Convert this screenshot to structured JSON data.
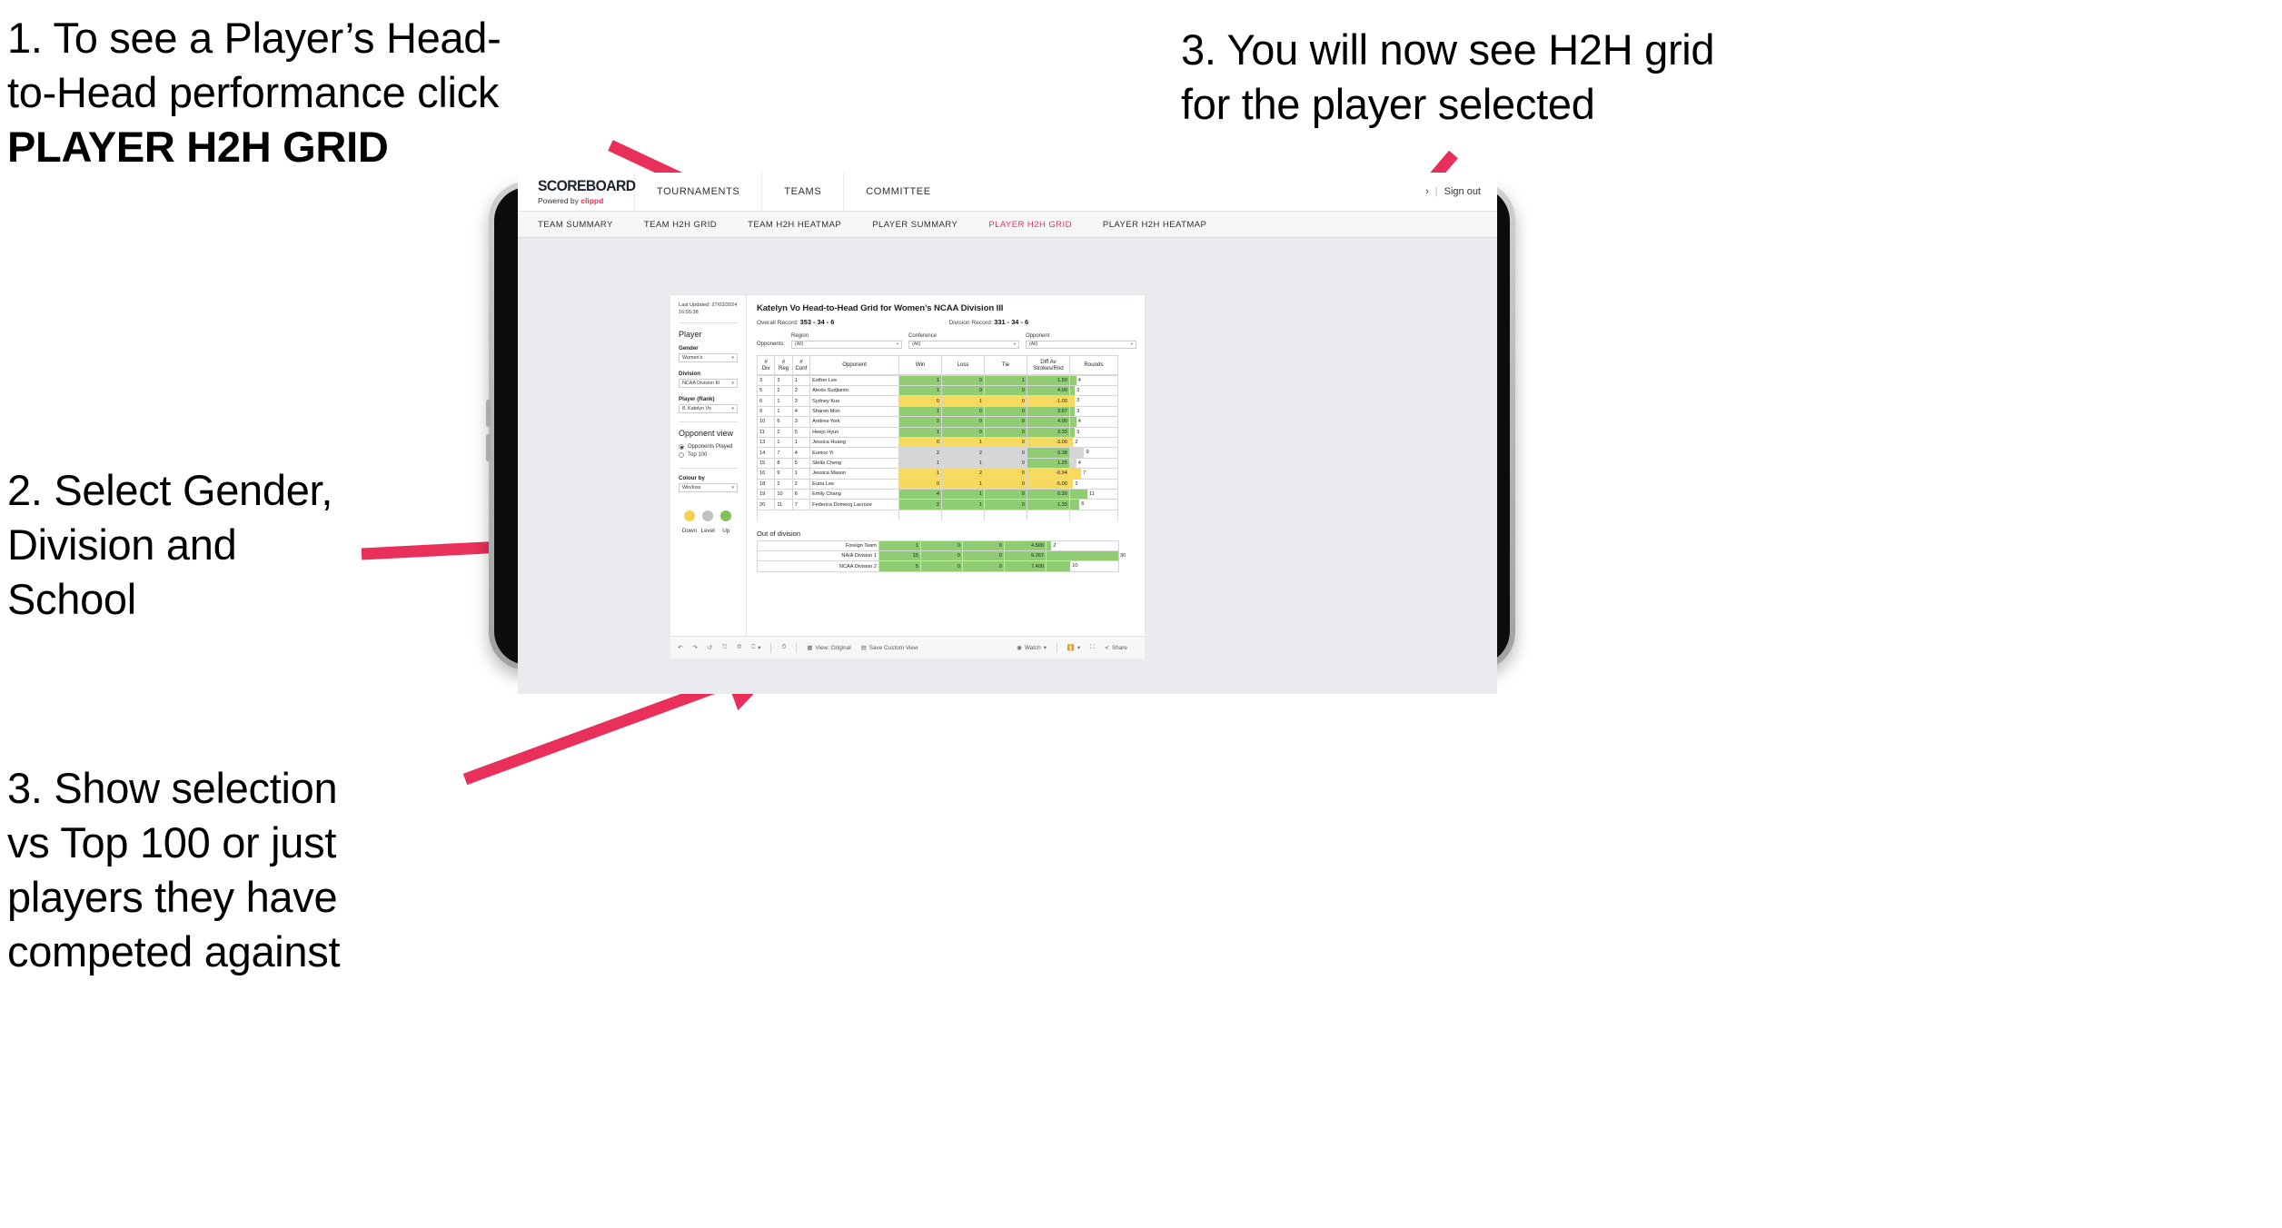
{
  "annotations": [
    {
      "id": "step1",
      "lines": [
        "1. To see a Player’s Head-",
        "to-Head performance click"
      ],
      "bold_line": "PLAYER H2H GRID"
    },
    {
      "id": "step2",
      "lines": [
        "2. Select Gender,",
        "Division and",
        "School"
      ]
    },
    {
      "id": "step3",
      "lines": [
        "3. Show selection",
        "vs Top 100 or just",
        "players they have",
        "competed against"
      ]
    },
    {
      "id": "step4",
      "lines": [
        "3. You will now see H2H grid",
        "for the player selected"
      ]
    }
  ],
  "accent_color": "#e8305a",
  "app": {
    "brand": {
      "name": "SCOREBOARD",
      "tagline_prefix": "Powered by ",
      "tagline_brand": "clippd"
    },
    "topnav": [
      "TOURNAMENTS",
      "TEAMS",
      "COMMITTEE"
    ],
    "account": {
      "chevron": "›",
      "separator": "|",
      "signout": "Sign out"
    },
    "subnav": [
      {
        "label": "TEAM SUMMARY",
        "active": false
      },
      {
        "label": "TEAM H2H GRID",
        "active": false
      },
      {
        "label": "TEAM H2H HEATMAP",
        "active": false
      },
      {
        "label": "PLAYER SUMMARY",
        "active": false
      },
      {
        "label": "PLAYER H2H GRID",
        "active": true
      },
      {
        "label": "PLAYER H2H HEATMAP",
        "active": false
      }
    ]
  },
  "filters": {
    "last_updated_label": "Last Updated: 27/03/2024",
    "last_updated_time": "16:55:38",
    "player_section_title": "Player",
    "gender": {
      "label": "Gender",
      "value": "Women's"
    },
    "division": {
      "label": "Division",
      "value": "NCAA Division III"
    },
    "player_rank": {
      "label": "Player (Rank)",
      "value": "8. Katelyn Vo"
    },
    "opponent_view": {
      "title": "Opponent view",
      "options": [
        {
          "label": "Opponents Played",
          "selected": true
        },
        {
          "label": "Top 100",
          "selected": false
        }
      ]
    },
    "colour_by": {
      "label": "Colour by",
      "value": "Win/loss"
    },
    "legend": [
      {
        "label": "Down",
        "color": "#f2d24b"
      },
      {
        "label": "Level",
        "color": "#bfc1c3"
      },
      {
        "label": "Up",
        "color": "#7ec35a"
      }
    ]
  },
  "viz": {
    "title": "Katelyn Vo Head-to-Head Grid for Women’s NCAA Division III",
    "overall_record_label": "Overall Record:",
    "overall_record_value": "353 -  34 - 6",
    "division_record_label": "Division Record:",
    "division_record_value": "331 -  34 - 6",
    "opponents_label": "Opponents:",
    "opponent_filters": [
      {
        "title": "Region",
        "value": "(All)"
      },
      {
        "title": "Conference",
        "value": "(All)"
      },
      {
        "title": "Opponent",
        "value": "(All)"
      }
    ],
    "columns": [
      "#\nDiv",
      "#\nReg",
      "#\nConf",
      "Opponent",
      "Win",
      "Loss",
      "Tie",
      "Diff Av\nStrokes/Rnd",
      "Rounds"
    ],
    "column_labels": {
      "div_1": "#",
      "div_2": "Div",
      "reg_1": "#",
      "reg_2": "Reg",
      "conf_1": "#",
      "conf_2": "Conf",
      "opponent": "Opponent",
      "win": "Win",
      "loss": "Loss",
      "tie": "Tie",
      "diff_1": "Diff Av",
      "diff_2": "Strokes/Rnd",
      "rounds": "Rounds"
    },
    "out_of_division_title": "Out of division"
  },
  "chart_data": {
    "type": "table",
    "title": "Katelyn Vo Head-to-Head Grid for Women’s NCAA Division III",
    "columns": [
      "# Div",
      "# Reg",
      "# Conf",
      "Opponent",
      "Win",
      "Loss",
      "Tie",
      "Diff Av Strokes/Rnd",
      "Rounds"
    ],
    "rows": [
      {
        "div": "3",
        "reg": "3",
        "conf": "1",
        "opponent": "Esther Lee",
        "win": "1",
        "loss": "0",
        "tie": "1",
        "diff": "1.50",
        "rounds": "4",
        "state": "up"
      },
      {
        "div": "5",
        "reg": "2",
        "conf": "2",
        "opponent": "Alexis Sudjianto",
        "win": "1",
        "loss": "0",
        "tie": "0",
        "diff": "4.00",
        "rounds": "3",
        "state": "up"
      },
      {
        "div": "6",
        "reg": "1",
        "conf": "3",
        "opponent": "Sydney Kuo",
        "win": "0",
        "loss": "1",
        "tie": "0",
        "diff": "-1.00",
        "rounds": "3",
        "state": "down"
      },
      {
        "div": "9",
        "reg": "1",
        "conf": "4",
        "opponent": "Sharon Mun",
        "win": "1",
        "loss": "0",
        "tie": "0",
        "diff": "3.67",
        "rounds": "3",
        "state": "up"
      },
      {
        "div": "10",
        "reg": "6",
        "conf": "3",
        "opponent": "Andrea York",
        "win": "2",
        "loss": "0",
        "tie": "0",
        "diff": "4.00",
        "rounds": "4",
        "state": "up"
      },
      {
        "div": "11",
        "reg": "2",
        "conf": "5",
        "opponent": "Heejo Hyun",
        "win": "1",
        "loss": "0",
        "tie": "0",
        "diff": "3.33",
        "rounds": "3",
        "state": "up"
      },
      {
        "div": "13",
        "reg": "1",
        "conf": "1",
        "opponent": "Jessica Huang",
        "win": "0",
        "loss": "1",
        "tie": "0",
        "diff": "-3.00",
        "rounds": "2",
        "state": "down"
      },
      {
        "div": "14",
        "reg": "7",
        "conf": "4",
        "opponent": "Eunice Yi",
        "win": "2",
        "loss": "2",
        "tie": "0",
        "diff": "0.38",
        "rounds": "9",
        "state": "level"
      },
      {
        "div": "15",
        "reg": "8",
        "conf": "5",
        "opponent": "Stella Cheng",
        "win": "1",
        "loss": "1",
        "tie": "0",
        "diff": "1.25",
        "rounds": "4",
        "state": "level"
      },
      {
        "div": "16",
        "reg": "9",
        "conf": "1",
        "opponent": "Jessica Mason",
        "win": "1",
        "loss": "2",
        "tie": "0",
        "diff": "-0.94",
        "rounds": "7",
        "state": "down"
      },
      {
        "div": "18",
        "reg": "2",
        "conf": "2",
        "opponent": "Euna Lee",
        "win": "0",
        "loss": "1",
        "tie": "0",
        "diff": "-5.00",
        "rounds": "2",
        "state": "down"
      },
      {
        "div": "19",
        "reg": "10",
        "conf": "6",
        "opponent": "Emily Chang",
        "win": "4",
        "loss": "1",
        "tie": "0",
        "diff": "0.30",
        "rounds": "11",
        "state": "up"
      },
      {
        "div": "20",
        "reg": "11",
        "conf": "7",
        "opponent": "Federica Domecq Lacroze",
        "win": "2",
        "loss": "1",
        "tie": "0",
        "diff": "1.33",
        "rounds": "6",
        "state": "up"
      }
    ],
    "out_of_division": [
      {
        "name": "Foreign Team",
        "win": "1",
        "loss": "0",
        "tie": "0",
        "diff": "4.500",
        "rounds": "2",
        "state": "up"
      },
      {
        "name": "NAIA Division 1",
        "win": "15",
        "loss": "0",
        "tie": "0",
        "diff": "9.267",
        "rounds": "30",
        "state": "up"
      },
      {
        "name": "NCAA Division 2",
        "win": "5",
        "loss": "0",
        "tie": "0",
        "diff": "7.400",
        "rounds": "10",
        "state": "up"
      }
    ],
    "colors": {
      "up": "#8fcc72",
      "down": "#f5da5f",
      "level": "#d4d6d7"
    },
    "max_rounds": 30
  },
  "toolbar": {
    "items": [
      {
        "icon": "undo-icon",
        "label": ""
      },
      {
        "icon": "redo-icon",
        "label": ""
      },
      {
        "icon": "revert-icon",
        "label": ""
      },
      {
        "icon": "refresh-data-icon",
        "label": ""
      },
      {
        "icon": "pause-refresh-icon",
        "label": ""
      },
      {
        "icon": "highlight-icon",
        "label": "",
        "caret": "▾"
      }
    ],
    "clock_icon": "history-icon",
    "view_label": "View: Original",
    "save_custom_view_label": "Save Custom View",
    "watch_label": "Watch",
    "watch_caret": "▾",
    "download_caret": "▾",
    "share_label": "Share"
  }
}
